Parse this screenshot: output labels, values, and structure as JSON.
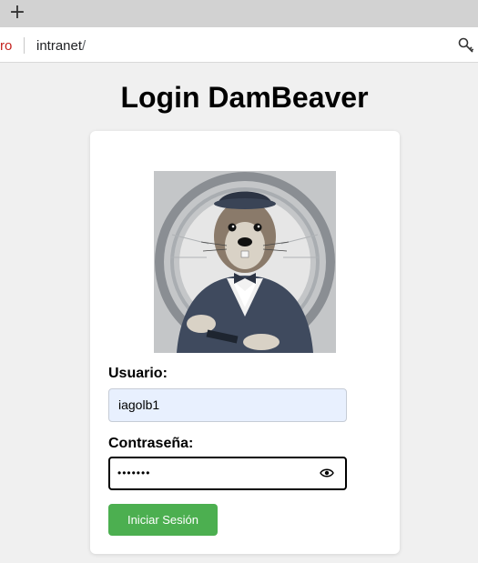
{
  "browser": {
    "new_tab_glyph": "+",
    "security_text": "ro",
    "url_host": "intranet",
    "url_path": "/",
    "key_icon": "key-icon"
  },
  "page": {
    "title": "Login DamBeaver"
  },
  "form": {
    "logo_icon": "beaver-logo-image",
    "username_label": "Usuario:",
    "username_value": "iagolb1",
    "password_label": "Contraseña:",
    "password_value": "•••••••",
    "password_toggle_icon": "eye-icon",
    "submit_label": "Iniciar Sesión"
  },
  "colors": {
    "background": "#f0f0f0",
    "autofill": "#e8f0fe",
    "submit": "#4caf50",
    "security_text": "#c5221f"
  }
}
